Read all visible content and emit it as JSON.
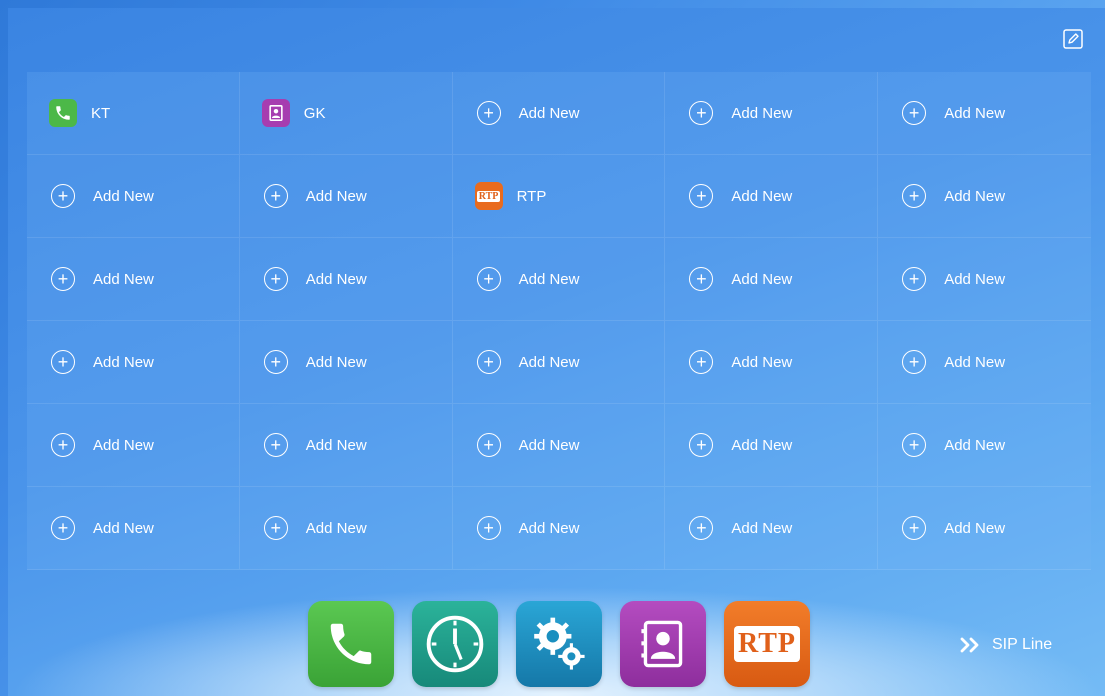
{
  "grid": {
    "cells": [
      {
        "label": "KT",
        "icon": "phone-icon",
        "color": "#4cb848"
      },
      {
        "label": "GK",
        "icon": "contacts-icon",
        "color": "#a63db0"
      },
      {
        "label": "Add New",
        "icon": "plus-circle-icon"
      },
      {
        "label": "Add New",
        "icon": "plus-circle-icon"
      },
      {
        "label": "Add New",
        "icon": "plus-circle-icon"
      },
      {
        "label": "Add New",
        "icon": "plus-circle-icon"
      },
      {
        "label": "Add New",
        "icon": "plus-circle-icon"
      },
      {
        "label": "RTP",
        "icon": "rtp-icon",
        "color": "#e96b1e"
      },
      {
        "label": "Add New",
        "icon": "plus-circle-icon"
      },
      {
        "label": "Add New",
        "icon": "plus-circle-icon"
      },
      {
        "label": "Add New",
        "icon": "plus-circle-icon"
      },
      {
        "label": "Add New",
        "icon": "plus-circle-icon"
      },
      {
        "label": "Add New",
        "icon": "plus-circle-icon"
      },
      {
        "label": "Add New",
        "icon": "plus-circle-icon"
      },
      {
        "label": "Add New",
        "icon": "plus-circle-icon"
      },
      {
        "label": "Add New",
        "icon": "plus-circle-icon"
      },
      {
        "label": "Add New",
        "icon": "plus-circle-icon"
      },
      {
        "label": "Add New",
        "icon": "plus-circle-icon"
      },
      {
        "label": "Add New",
        "icon": "plus-circle-icon"
      },
      {
        "label": "Add New",
        "icon": "plus-circle-icon"
      },
      {
        "label": "Add New",
        "icon": "plus-circle-icon"
      },
      {
        "label": "Add New",
        "icon": "plus-circle-icon"
      },
      {
        "label": "Add New",
        "icon": "plus-circle-icon"
      },
      {
        "label": "Add New",
        "icon": "plus-circle-icon"
      },
      {
        "label": "Add New",
        "icon": "plus-circle-icon"
      },
      {
        "label": "Add New",
        "icon": "plus-circle-icon"
      },
      {
        "label": "Add New",
        "icon": "plus-circle-icon"
      },
      {
        "label": "Add New",
        "icon": "plus-circle-icon"
      },
      {
        "label": "Add New",
        "icon": "plus-circle-icon"
      },
      {
        "label": "Add New",
        "icon": "plus-circle-icon"
      }
    ]
  },
  "dock": {
    "apps": [
      {
        "icon": "phone-icon",
        "color": "#4cb848"
      },
      {
        "icon": "clock-icon",
        "color": "#1f9a86"
      },
      {
        "icon": "settings-gears-icon",
        "color": "#1a8fbf"
      },
      {
        "icon": "contacts-icon",
        "color": "#a63db0"
      },
      {
        "icon": "rtp-icon",
        "color": "#e96b1e",
        "label": "RTP"
      }
    ]
  },
  "footer": {
    "sip_line_label": "SIP Line"
  },
  "header": {
    "edit_icon": "edit-icon"
  }
}
